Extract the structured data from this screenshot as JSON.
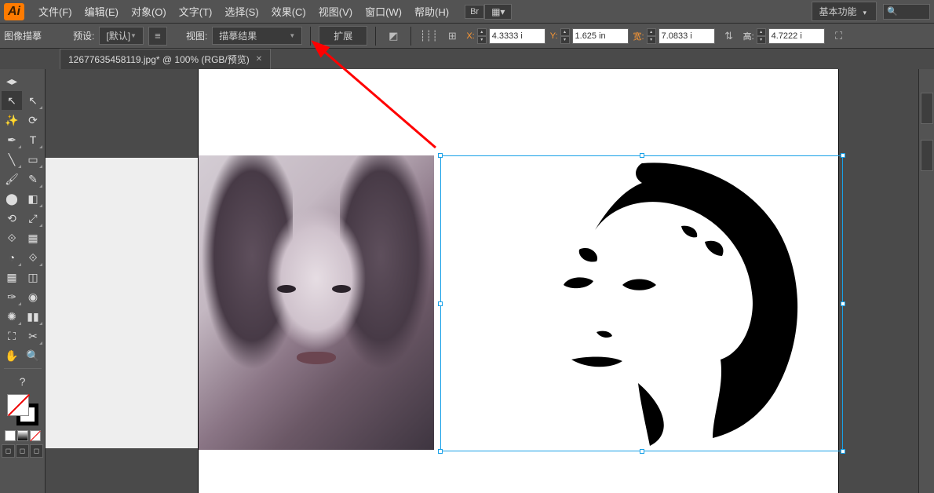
{
  "menu": {
    "items": [
      "文件(F)",
      "编辑(E)",
      "对象(O)",
      "文字(T)",
      "选择(S)",
      "效果(C)",
      "视图(V)",
      "窗口(W)",
      "帮助(H)"
    ],
    "bridge": "Br",
    "workspace": "基本功能"
  },
  "control": {
    "context_label": "图像描摹",
    "preset_label": "预设:",
    "preset_value": "[默认]",
    "view_label": "视图:",
    "view_value": "描摹结果",
    "expand": "扩展",
    "x_label": "X:",
    "x_value": "4.3333 i",
    "y_label": "Y:",
    "y_value": "1.625 in",
    "w_label": "宽:",
    "w_value": "7.0833 i",
    "h_label": "高:",
    "h_value": "4.7222 i"
  },
  "document": {
    "tab_title": "12677635458119.jpg* @ 100% (RGB/预览)"
  },
  "tools": [
    "▭",
    "↖",
    "⁎",
    "✥",
    "Q",
    "✎",
    "T",
    "╱",
    "▭",
    "✎",
    "▭",
    "⟳",
    "⌷",
    "✂",
    "⟐",
    "▦",
    "☷",
    "◫",
    "⎋",
    "⤢",
    "◇",
    "✎",
    "◧",
    "⟡",
    "⛶",
    "◱",
    "⟀",
    "⛏",
    "⌕",
    "✥",
    "⊕",
    "",
    "?"
  ]
}
